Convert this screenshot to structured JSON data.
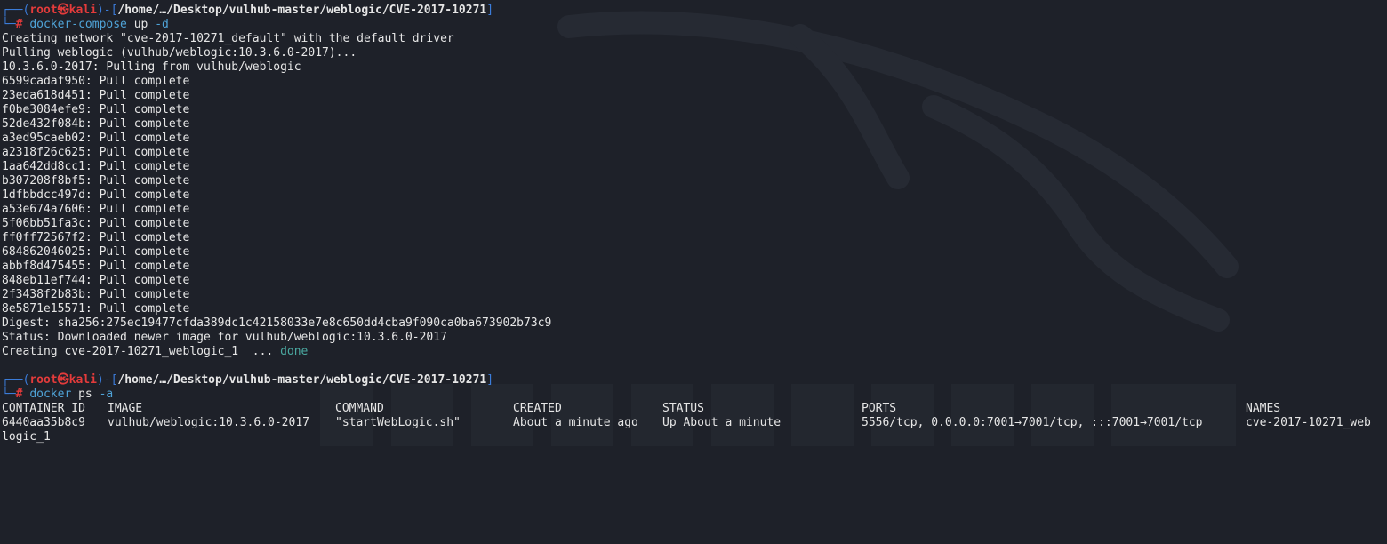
{
  "prompt1": {
    "corner_top": "┌──(",
    "user": "root㉿kali",
    "mid": ")-[",
    "path": "/home/…/Desktop/vulhub-master/weblogic/CVE-2017-10271",
    "end": "]",
    "corner_bottom": "└─",
    "hash": "#",
    "command": "docker-compose",
    "args": " up ",
    "flag": "-d"
  },
  "output1": [
    "Creating network \"cve-2017-10271_default\" with the default driver",
    "Pulling weblogic (vulhub/weblogic:10.3.6.0-2017)...",
    "10.3.6.0-2017: Pulling from vulhub/weblogic",
    "6599cadaf950: Pull complete",
    "23eda618d451: Pull complete",
    "f0be3084efe9: Pull complete",
    "52de432f084b: Pull complete",
    "a3ed95caeb02: Pull complete",
    "a2318f26c625: Pull complete",
    "1aa642dd8cc1: Pull complete",
    "b307208f8bf5: Pull complete",
    "1dfbbdcc497d: Pull complete",
    "a53e674a7606: Pull complete",
    "5f06bb51fa3c: Pull complete",
    "ff0ff72567f2: Pull complete",
    "684862046025: Pull complete",
    "abbf8d475455: Pull complete",
    "848eb11ef744: Pull complete",
    "2f3438f2b83b: Pull complete",
    "8e5871e15571: Pull complete",
    "Digest: sha256:275ec19477cfda389dc1c42158033e7e8c650dd4cba9f090ca0ba673902b73c9",
    "Status: Downloaded newer image for vulhub/weblogic:10.3.6.0-2017"
  ],
  "creating_line": {
    "text": "Creating cve-2017-10271_weblogic_1  ... ",
    "status": "done"
  },
  "prompt2": {
    "corner_top": "┌──(",
    "user": "root㉿kali",
    "mid": ")-[",
    "path": "/home/…/Desktop/vulhub-master/weblogic/CVE-2017-10271",
    "end": "]",
    "corner_bottom": "└─",
    "hash": "#",
    "command": "docker",
    "args": " ps ",
    "flag": "-a"
  },
  "ps_table": {
    "headers": [
      "CONTAINER ID",
      "IMAGE",
      "COMMAND",
      "CREATED",
      "STATUS",
      "PORTS",
      "NAMES"
    ],
    "row": [
      "6440aa35b8c9",
      "vulhub/weblogic:10.3.6.0-2017",
      "\"startWebLogic.sh\"",
      "About a minute ago",
      "Up About a minute",
      "5556/tcp, 0.0.0.0:7001→7001/tcp, :::7001→7001/tcp",
      "cve-2017-10271_web"
    ],
    "wrap": "logic_1"
  },
  "colors": {
    "background": "#1e2129",
    "prompt_blue": "#3b7cd9",
    "user_red": "#e33b3b",
    "command_blue": "#4fa3d7",
    "done_teal": "#4aa8a0"
  }
}
